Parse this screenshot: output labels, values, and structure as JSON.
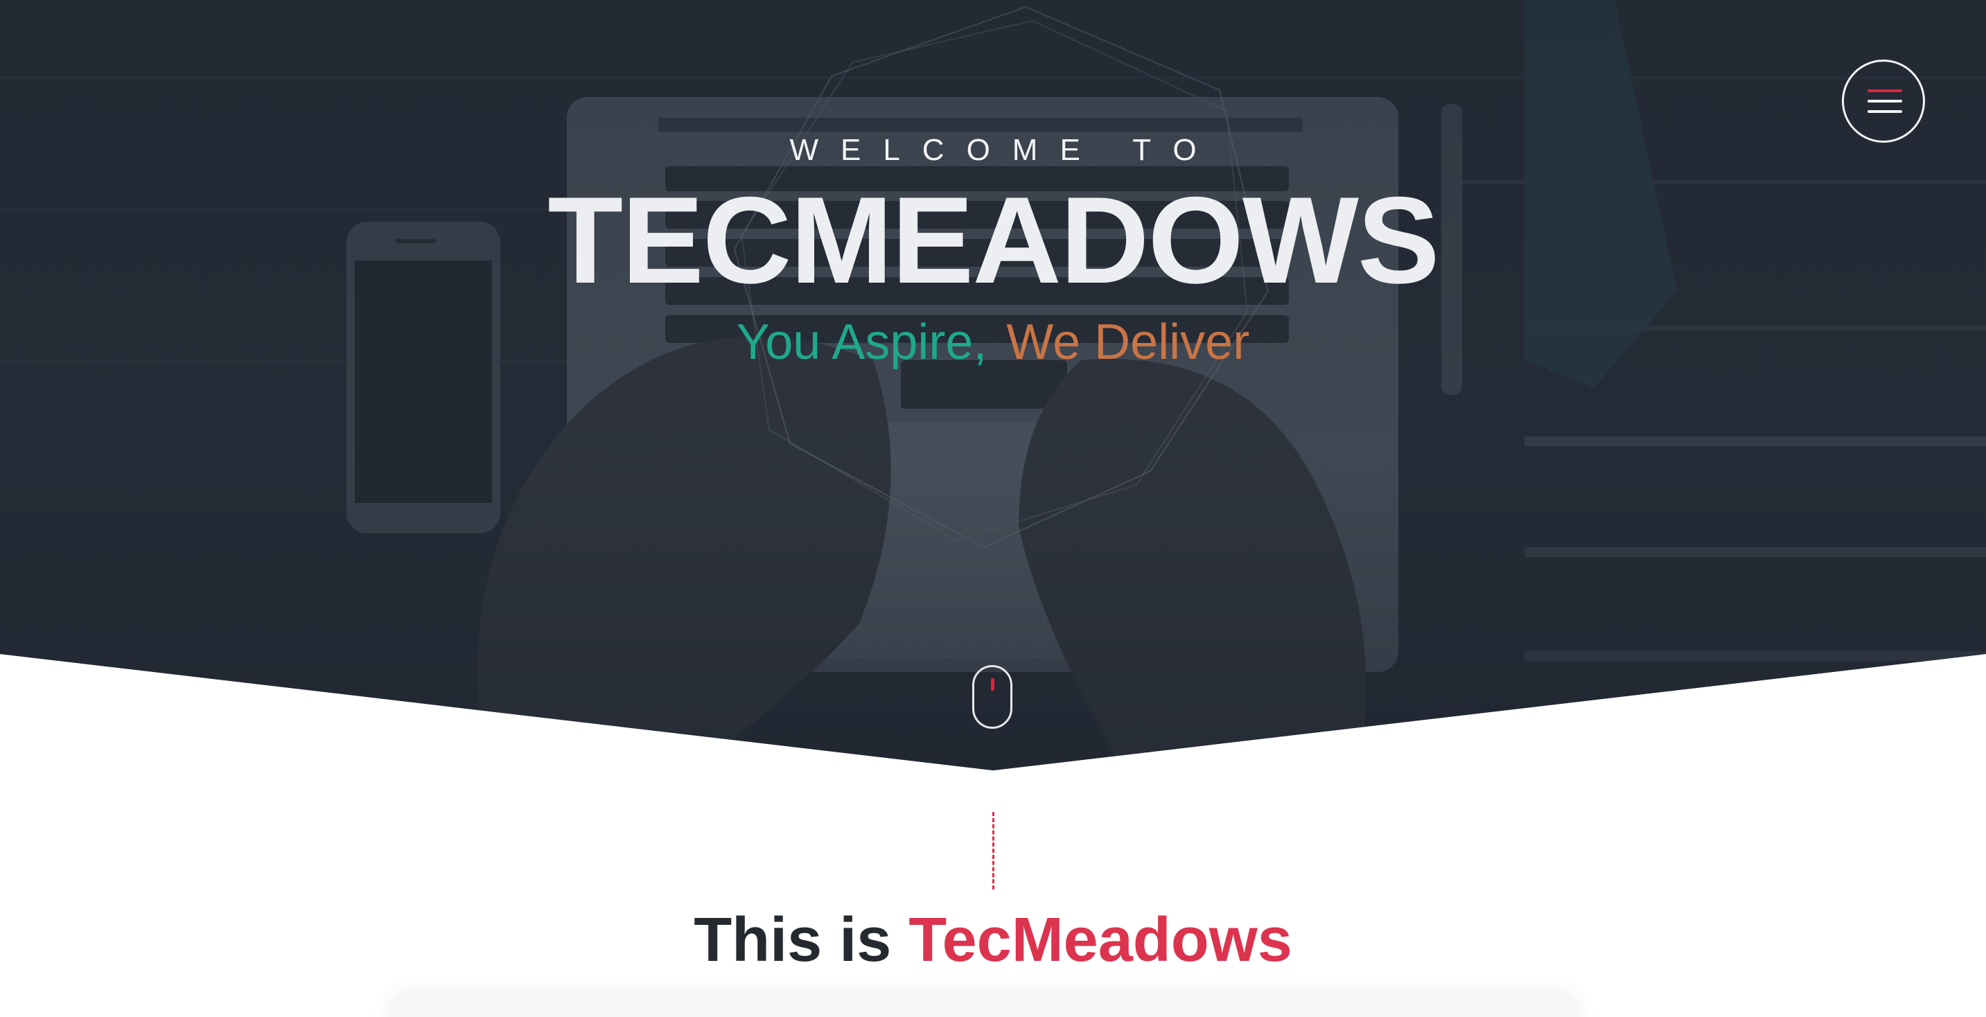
{
  "hero": {
    "welcome_text": "WELCOME TO",
    "brand_name": "TECMEADOWS",
    "tagline_part1": "You Aspire,",
    "tagline_part2": "We Deliver",
    "colors": {
      "tagline_part1": "#1fa98c",
      "tagline_part2": "#c97545",
      "accent": "#e0243f"
    }
  },
  "nav": {
    "menu_icon": "hamburger-menu-icon"
  },
  "scroll_indicator": {
    "icon": "mouse-scroll-icon"
  },
  "intro": {
    "title_prefix": "This is",
    "title_brand": "TecMeadows",
    "colors": {
      "title": "#252a30",
      "brand": "#dc344e"
    }
  }
}
